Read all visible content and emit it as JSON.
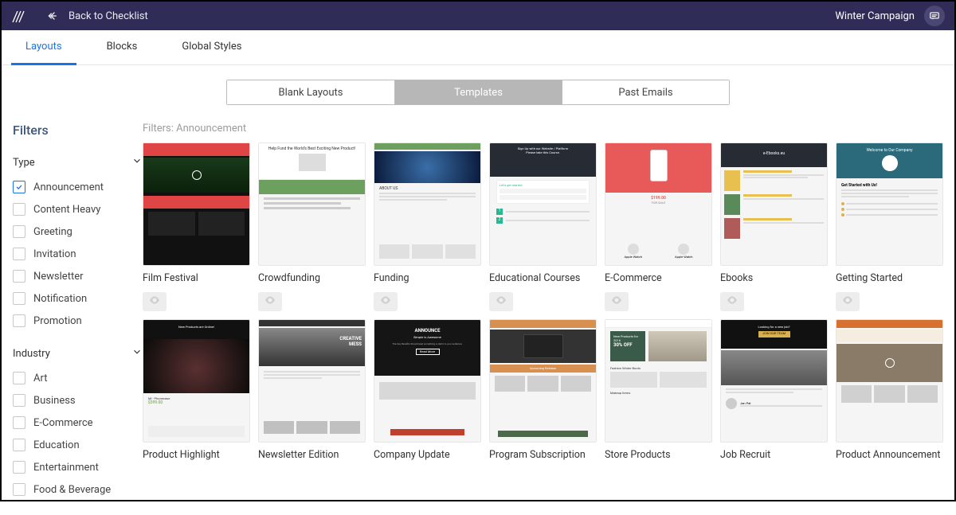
{
  "topbar": {
    "back_label": "Back to Checklist",
    "campaign": "Winter Campaign"
  },
  "tabs": [
    "Layouts",
    "Blocks",
    "Global Styles"
  ],
  "active_tab": 0,
  "segments": [
    "Blank Layouts",
    "Templates",
    "Past Emails"
  ],
  "active_segment": 1,
  "filters_title": "Filters",
  "applied_filters_label": "Filters: Announcement",
  "filter_sections": [
    {
      "name": "Type",
      "options": [
        {
          "label": "Announcement",
          "checked": true
        },
        {
          "label": "Content Heavy",
          "checked": false
        },
        {
          "label": "Greeting",
          "checked": false
        },
        {
          "label": "Invitation",
          "checked": false
        },
        {
          "label": "Newsletter",
          "checked": false
        },
        {
          "label": "Notification",
          "checked": false
        },
        {
          "label": "Promotion",
          "checked": false
        }
      ]
    },
    {
      "name": "Industry",
      "options": [
        {
          "label": "Art",
          "checked": false
        },
        {
          "label": "Business",
          "checked": false
        },
        {
          "label": "E-Commerce",
          "checked": false
        },
        {
          "label": "Education",
          "checked": false
        },
        {
          "label": "Entertainment",
          "checked": false
        },
        {
          "label": "Food & Beverage",
          "checked": false
        }
      ]
    }
  ],
  "templates_row1": [
    {
      "title": "Film Festival",
      "style": "film"
    },
    {
      "title": "Crowdfunding",
      "style": "crowd"
    },
    {
      "title": "Funding",
      "style": "funding"
    },
    {
      "title": "Educational Courses",
      "style": "course"
    },
    {
      "title": "E-Commerce",
      "style": "ecom"
    },
    {
      "title": "Ebooks",
      "style": "ebook"
    },
    {
      "title": "Getting Started",
      "style": "start"
    }
  ],
  "templates_row2": [
    {
      "title": "Product Highlight",
      "style": "product"
    },
    {
      "title": "Newsletter Edition",
      "style": "newsl"
    },
    {
      "title": "Company Update",
      "style": "update"
    },
    {
      "title": "Program Subscription",
      "style": "program"
    },
    {
      "title": "Store Products",
      "style": "store"
    },
    {
      "title": "Job Recruit",
      "style": "job"
    },
    {
      "title": "Product Announcement",
      "style": "prodann"
    }
  ]
}
